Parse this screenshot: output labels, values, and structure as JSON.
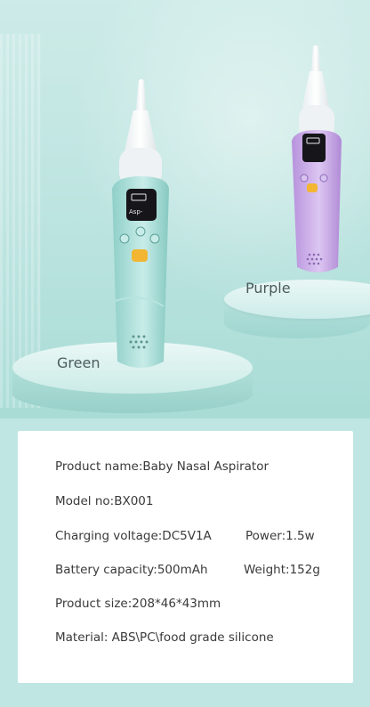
{
  "scene": {
    "labels": {
      "green": "Green",
      "purple": "Purple"
    },
    "device_colors": {
      "green": "#a6dcd6",
      "purple": "#c9a6e6",
      "screen": "#15151a",
      "button_accent": "#f2b632"
    },
    "screen_text": "Asp-"
  },
  "specs": {
    "product_name": "Product name:Baby Nasal Aspirator",
    "model": "Model no:BX001",
    "charging_voltage": "Charging voltage:DC5V1A",
    "power": "Power:1.5w",
    "battery": "Battery capacity:500mAh",
    "weight": "Weight:152g",
    "size": "Product size:208*46*43mm",
    "material": "Material: ABS\\PC\\food grade silicone"
  }
}
